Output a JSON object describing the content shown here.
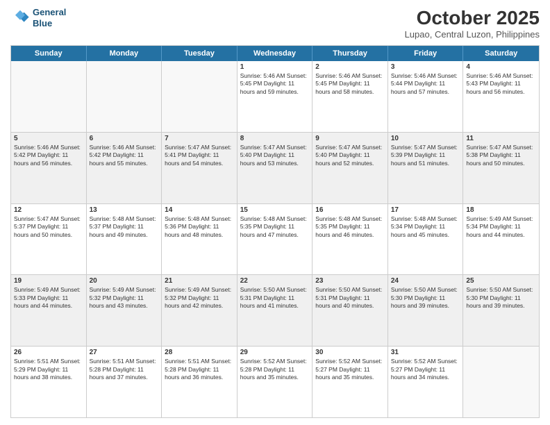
{
  "header": {
    "logo_line1": "General",
    "logo_line2": "Blue",
    "month_title": "October 2025",
    "subtitle": "Lupao, Central Luzon, Philippines"
  },
  "day_names": [
    "Sunday",
    "Monday",
    "Tuesday",
    "Wednesday",
    "Thursday",
    "Friday",
    "Saturday"
  ],
  "weeks": [
    [
      {
        "day": "",
        "info": "",
        "empty": true
      },
      {
        "day": "",
        "info": "",
        "empty": true
      },
      {
        "day": "",
        "info": "",
        "empty": true
      },
      {
        "day": "1",
        "info": "Sunrise: 5:46 AM\nSunset: 5:45 PM\nDaylight: 11 hours\nand 59 minutes."
      },
      {
        "day": "2",
        "info": "Sunrise: 5:46 AM\nSunset: 5:45 PM\nDaylight: 11 hours\nand 58 minutes."
      },
      {
        "day": "3",
        "info": "Sunrise: 5:46 AM\nSunset: 5:44 PM\nDaylight: 11 hours\nand 57 minutes."
      },
      {
        "day": "4",
        "info": "Sunrise: 5:46 AM\nSunset: 5:43 PM\nDaylight: 11 hours\nand 56 minutes."
      }
    ],
    [
      {
        "day": "5",
        "info": "Sunrise: 5:46 AM\nSunset: 5:42 PM\nDaylight: 11 hours\nand 56 minutes.",
        "shaded": true
      },
      {
        "day": "6",
        "info": "Sunrise: 5:46 AM\nSunset: 5:42 PM\nDaylight: 11 hours\nand 55 minutes.",
        "shaded": true
      },
      {
        "day": "7",
        "info": "Sunrise: 5:47 AM\nSunset: 5:41 PM\nDaylight: 11 hours\nand 54 minutes.",
        "shaded": true
      },
      {
        "day": "8",
        "info": "Sunrise: 5:47 AM\nSunset: 5:40 PM\nDaylight: 11 hours\nand 53 minutes.",
        "shaded": true
      },
      {
        "day": "9",
        "info": "Sunrise: 5:47 AM\nSunset: 5:40 PM\nDaylight: 11 hours\nand 52 minutes.",
        "shaded": true
      },
      {
        "day": "10",
        "info": "Sunrise: 5:47 AM\nSunset: 5:39 PM\nDaylight: 11 hours\nand 51 minutes.",
        "shaded": true
      },
      {
        "day": "11",
        "info": "Sunrise: 5:47 AM\nSunset: 5:38 PM\nDaylight: 11 hours\nand 50 minutes.",
        "shaded": true
      }
    ],
    [
      {
        "day": "12",
        "info": "Sunrise: 5:47 AM\nSunset: 5:37 PM\nDaylight: 11 hours\nand 50 minutes."
      },
      {
        "day": "13",
        "info": "Sunrise: 5:48 AM\nSunset: 5:37 PM\nDaylight: 11 hours\nand 49 minutes."
      },
      {
        "day": "14",
        "info": "Sunrise: 5:48 AM\nSunset: 5:36 PM\nDaylight: 11 hours\nand 48 minutes."
      },
      {
        "day": "15",
        "info": "Sunrise: 5:48 AM\nSunset: 5:35 PM\nDaylight: 11 hours\nand 47 minutes."
      },
      {
        "day": "16",
        "info": "Sunrise: 5:48 AM\nSunset: 5:35 PM\nDaylight: 11 hours\nand 46 minutes."
      },
      {
        "day": "17",
        "info": "Sunrise: 5:48 AM\nSunset: 5:34 PM\nDaylight: 11 hours\nand 45 minutes."
      },
      {
        "day": "18",
        "info": "Sunrise: 5:49 AM\nSunset: 5:34 PM\nDaylight: 11 hours\nand 44 minutes."
      }
    ],
    [
      {
        "day": "19",
        "info": "Sunrise: 5:49 AM\nSunset: 5:33 PM\nDaylight: 11 hours\nand 44 minutes.",
        "shaded": true
      },
      {
        "day": "20",
        "info": "Sunrise: 5:49 AM\nSunset: 5:32 PM\nDaylight: 11 hours\nand 43 minutes.",
        "shaded": true
      },
      {
        "day": "21",
        "info": "Sunrise: 5:49 AM\nSunset: 5:32 PM\nDaylight: 11 hours\nand 42 minutes.",
        "shaded": true
      },
      {
        "day": "22",
        "info": "Sunrise: 5:50 AM\nSunset: 5:31 PM\nDaylight: 11 hours\nand 41 minutes.",
        "shaded": true
      },
      {
        "day": "23",
        "info": "Sunrise: 5:50 AM\nSunset: 5:31 PM\nDaylight: 11 hours\nand 40 minutes.",
        "shaded": true
      },
      {
        "day": "24",
        "info": "Sunrise: 5:50 AM\nSunset: 5:30 PM\nDaylight: 11 hours\nand 39 minutes.",
        "shaded": true
      },
      {
        "day": "25",
        "info": "Sunrise: 5:50 AM\nSunset: 5:30 PM\nDaylight: 11 hours\nand 39 minutes.",
        "shaded": true
      }
    ],
    [
      {
        "day": "26",
        "info": "Sunrise: 5:51 AM\nSunset: 5:29 PM\nDaylight: 11 hours\nand 38 minutes."
      },
      {
        "day": "27",
        "info": "Sunrise: 5:51 AM\nSunset: 5:28 PM\nDaylight: 11 hours\nand 37 minutes."
      },
      {
        "day": "28",
        "info": "Sunrise: 5:51 AM\nSunset: 5:28 PM\nDaylight: 11 hours\nand 36 minutes."
      },
      {
        "day": "29",
        "info": "Sunrise: 5:52 AM\nSunset: 5:28 PM\nDaylight: 11 hours\nand 35 minutes."
      },
      {
        "day": "30",
        "info": "Sunrise: 5:52 AM\nSunset: 5:27 PM\nDaylight: 11 hours\nand 35 minutes."
      },
      {
        "day": "31",
        "info": "Sunrise: 5:52 AM\nSunset: 5:27 PM\nDaylight: 11 hours\nand 34 minutes."
      },
      {
        "day": "",
        "info": "",
        "empty": true
      }
    ]
  ]
}
